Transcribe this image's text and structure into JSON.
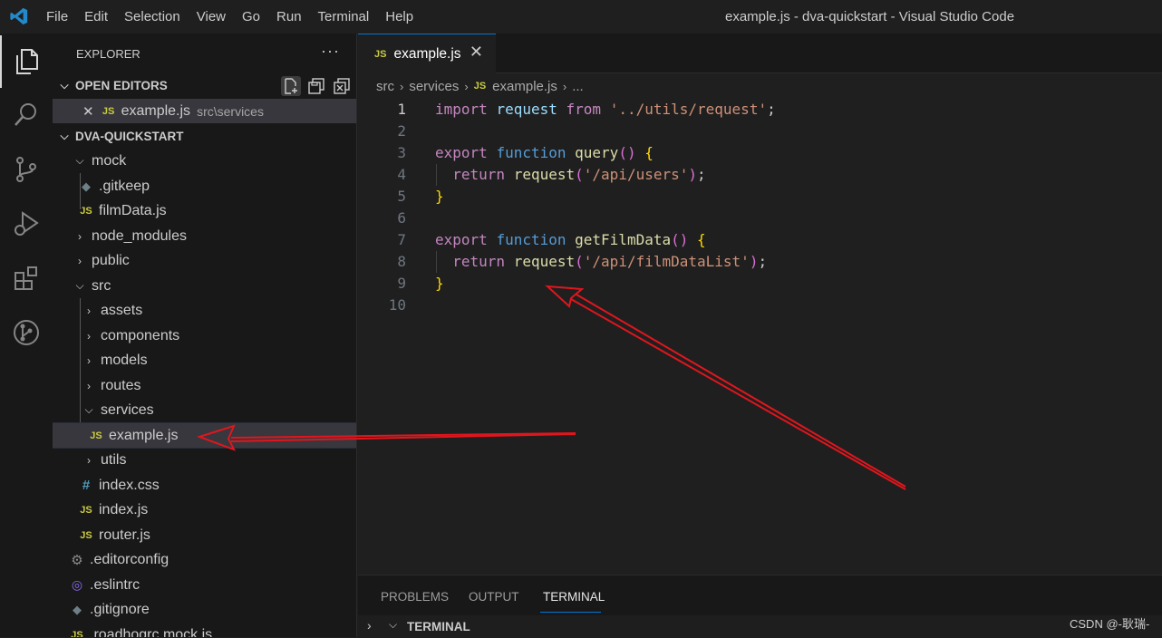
{
  "titlebar": {
    "menu": [
      "File",
      "Edit",
      "Selection",
      "View",
      "Go",
      "Run",
      "Terminal",
      "Help"
    ],
    "window_title": "example.js - dva-quickstart - Visual Studio Code"
  },
  "activity_bar": {
    "items": [
      "explorer-icon",
      "search-icon",
      "source-control-icon",
      "run-debug-icon",
      "extensions-icon",
      "git-graph-icon"
    ]
  },
  "explorer": {
    "header": "EXPLORER",
    "more": "···",
    "open_editors": {
      "title": "OPEN EDITORS",
      "items": [
        {
          "close": "✕",
          "icon": "JS",
          "name": "example.js",
          "path": "src\\services"
        }
      ]
    },
    "project": {
      "title": "DVA-QUICKSTART",
      "tree": [
        {
          "label": "mock",
          "type": "folder-open"
        },
        {
          "label": ".gitkeep",
          "type": "gitkeep"
        },
        {
          "label": "filmData.js",
          "type": "js"
        },
        {
          "label": "node_modules",
          "type": "folder"
        },
        {
          "label": "public",
          "type": "folder"
        },
        {
          "label": "src",
          "type": "folder-open"
        },
        {
          "label": "assets",
          "type": "folder"
        },
        {
          "label": "components",
          "type": "folder"
        },
        {
          "label": "models",
          "type": "folder"
        },
        {
          "label": "routes",
          "type": "folder"
        },
        {
          "label": "services",
          "type": "folder-open"
        },
        {
          "label": "example.js",
          "type": "js"
        },
        {
          "label": "utils",
          "type": "folder"
        },
        {
          "label": "index.css",
          "type": "css"
        },
        {
          "label": "index.js",
          "type": "js"
        },
        {
          "label": "router.js",
          "type": "js"
        },
        {
          "label": ".editorconfig",
          "type": "editorconfig"
        },
        {
          "label": ".eslintrc",
          "type": "eslint"
        },
        {
          "label": ".gitignore",
          "type": "gitignore"
        },
        {
          "label": ".roadhogrc.mock.js",
          "type": "js"
        }
      ]
    }
  },
  "editor": {
    "tab": {
      "icon": "JS",
      "label": "example.js",
      "close": "✕"
    },
    "breadcrumb": [
      "src",
      "services",
      "example.js",
      "..."
    ],
    "line_numbers": [
      "1",
      "2",
      "3",
      "4",
      "5",
      "6",
      "7",
      "8",
      "9",
      "10"
    ],
    "code": [
      "import request from '../utils/request';",
      "",
      "export function query() {",
      "  return request('/api/users');",
      "}",
      "",
      "export function getFilmData() {",
      "  return request('/api/filmDataList');",
      "}",
      ""
    ]
  },
  "panel": {
    "tabs": [
      "PROBLEMS",
      "OUTPUT",
      "TERMINAL"
    ],
    "active_tab": "TERMINAL",
    "section": "TERMINAL"
  },
  "watermark": "CSDN @-耿瑞-",
  "colors": {
    "accent": "#0078d4",
    "js_icon": "#cbcb41",
    "annotation_arrow": "#e0161d"
  }
}
